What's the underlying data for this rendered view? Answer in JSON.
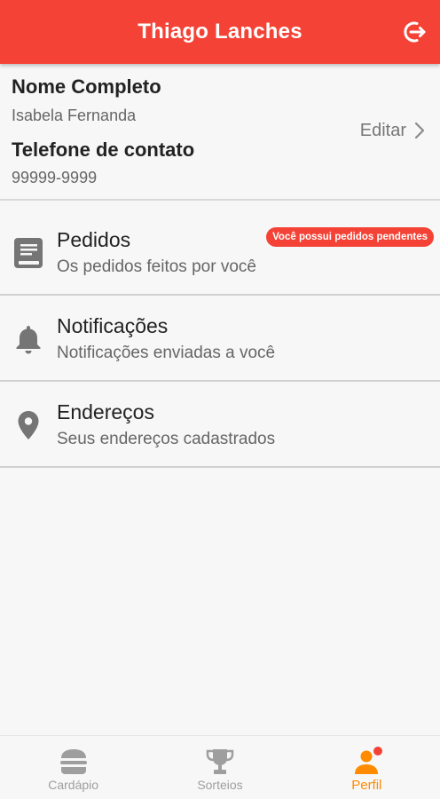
{
  "header": {
    "title": "Thiago Lanches",
    "logout_icon": "logout-icon"
  },
  "profile": {
    "name_label": "Nome Completo",
    "name_value": "Isabela Fernanda",
    "phone_label": "Telefone de contato",
    "phone_value": "99999-9999",
    "edit_label": "Editar",
    "edit_icon": "chevron-right-icon"
  },
  "menu": {
    "items": [
      {
        "title": "Pedidos",
        "subtitle": "Os pedidos feitos por você",
        "icon": "book-icon",
        "badge": "Você possui pedidos pendentes"
      },
      {
        "title": "Notificações",
        "subtitle": "Notificações enviadas a você",
        "icon": "bell-icon"
      },
      {
        "title": "Endereços",
        "subtitle": "Seus endereços cadastrados",
        "icon": "location-pin-icon"
      }
    ]
  },
  "bottom_nav": {
    "items": [
      {
        "label": "Cardápio",
        "icon": "burger-icon",
        "active": false
      },
      {
        "label": "Sorteios",
        "icon": "trophy-icon",
        "active": false
      },
      {
        "label": "Perfil",
        "icon": "person-icon",
        "active": true,
        "has_notification_dot": true
      }
    ]
  },
  "colors": {
    "primary": "#f44336",
    "active_nav": "#ff8c00",
    "inactive_nav": "#9e9e9e",
    "icon_gray": "#757575"
  }
}
